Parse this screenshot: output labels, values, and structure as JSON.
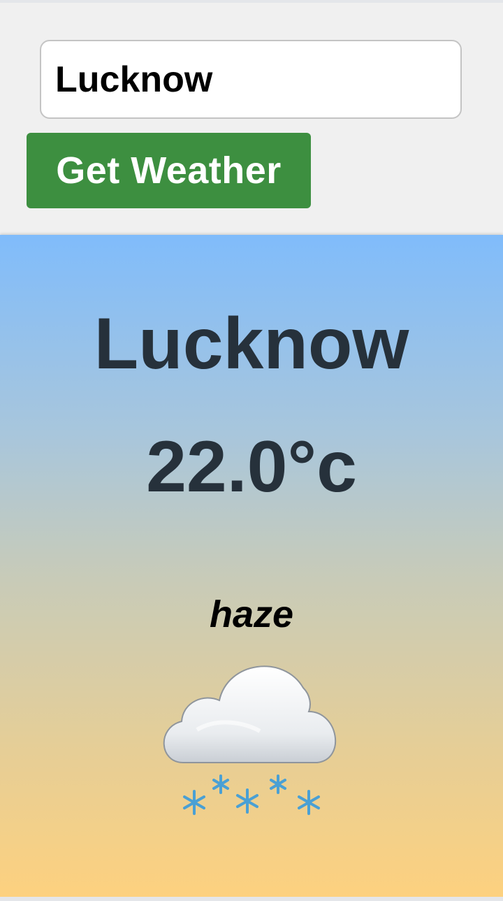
{
  "search": {
    "city_value": "Lucknow",
    "button_label": "Get Weather"
  },
  "weather": {
    "city": "Lucknow",
    "temperature": "22.0°c",
    "condition": "haze",
    "icon": "cloud-with-snow-icon"
  },
  "colors": {
    "button": "#3d8f40",
    "text_dark": "#26313b",
    "gradient_top": "#80bcfb",
    "gradient_bottom": "#fdd17f"
  }
}
